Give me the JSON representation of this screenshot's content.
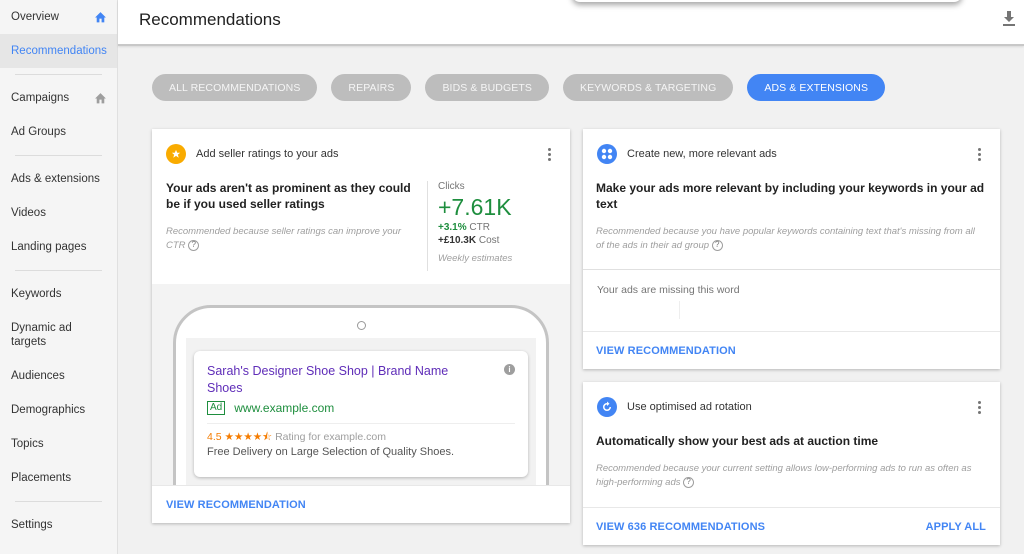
{
  "sidebar": {
    "groups": [
      [
        {
          "label": "Overview",
          "icon": "home-icon",
          "icon_color": "#4285f4"
        },
        {
          "label": "Recommendations",
          "active": true
        }
      ],
      [
        {
          "label": "Campaigns",
          "icon": "home-icon",
          "icon_color": "#9e9e9e"
        },
        {
          "label": "Ad Groups"
        }
      ],
      [
        {
          "label": "Ads & extensions"
        },
        {
          "label": "Videos"
        },
        {
          "label": "Landing pages"
        }
      ],
      [
        {
          "label": "Keywords"
        },
        {
          "label": "Dynamic ad targets"
        },
        {
          "label": "Audiences"
        },
        {
          "label": "Demographics"
        },
        {
          "label": "Topics"
        },
        {
          "label": "Placements"
        }
      ],
      [
        {
          "label": "Settings"
        }
      ]
    ]
  },
  "header": {
    "title": "Recommendations",
    "download_icon": "download-icon"
  },
  "filters": {
    "chips": [
      {
        "label": "ALL RECOMMENDATIONS",
        "active": false
      },
      {
        "label": "REPAIRS",
        "active": false
      },
      {
        "label": "BIDS & BUDGETS",
        "active": false
      },
      {
        "label": "KEYWORDS & TARGETING",
        "active": false
      },
      {
        "label": "ADS & EXTENSIONS",
        "active": true
      }
    ]
  },
  "cards": {
    "seller_ratings": {
      "icon": "star-icon",
      "icon_color": "#f9ab00",
      "label": "Add seller ratings to your ads",
      "headline": "Your ads aren't as prominent as they could be if you used seller ratings",
      "reason": "Recommended because seller ratings can improve your CTR",
      "stats": {
        "label": "Clicks",
        "value": "+7.61K",
        "ctr_value": "+3.1%",
        "ctr_label": "CTR",
        "cost_value": "+£10.3K",
        "cost_label": "Cost",
        "note": "Weekly estimates"
      },
      "ad_preview": {
        "title": "Sarah's Designer Shoe Shop | Brand Name Shoes",
        "tag": "Ad",
        "url": "www.example.com",
        "rating_value": "4.5",
        "stars": "★★★★⯪",
        "rating_text": "Rating for example.com",
        "description": "Free Delivery on Large Selection of Quality Shoes."
      },
      "action": "VIEW RECOMMENDATION"
    },
    "relevant_ads": {
      "icon": "apps-icon",
      "icon_color": "#4285f4",
      "label": "Create new, more relevant ads",
      "headline": "Make your ads more relevant by including your keywords in your ad text",
      "reason": "Recommended because you have popular keywords containing text that's missing from all of the ads in their ad group",
      "missing_label": "Your ads are missing this word",
      "action": "VIEW RECOMMENDATION"
    },
    "ad_rotation": {
      "icon": "refresh-icon",
      "icon_color": "#4285f4",
      "label": "Use optimised ad rotation",
      "headline": "Automatically show your best ads at auction time",
      "reason": "Recommended because your current setting allows low-performing ads to run as often as high-performing ads",
      "action": "VIEW 636 RECOMMENDATIONS",
      "secondary_action": "APPLY ALL"
    }
  }
}
